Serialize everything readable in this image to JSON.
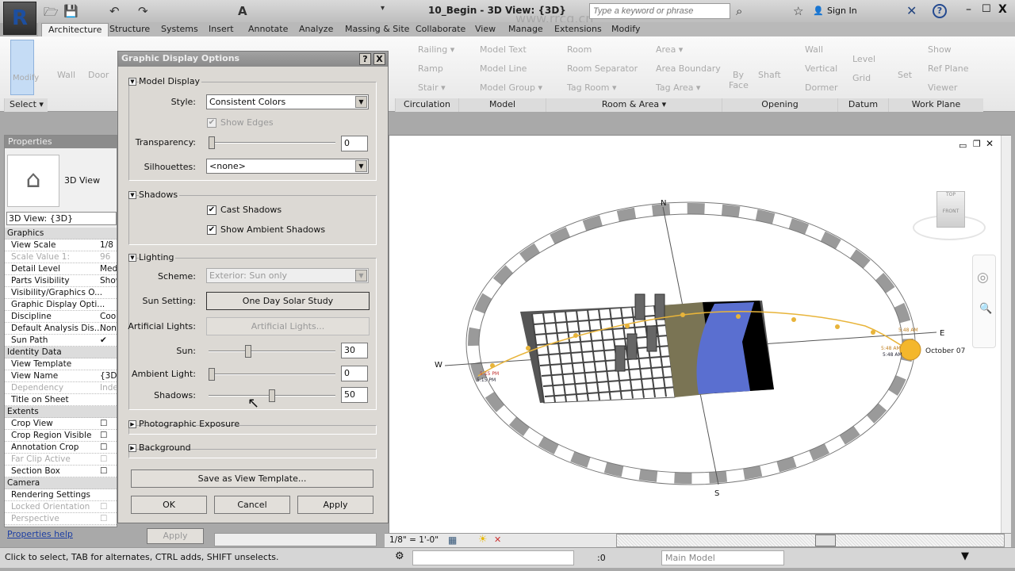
{
  "app": {
    "logo": "R",
    "window_title": "10_Begin - 3D View: {3D}",
    "search_placeholder": "Type a keyword or phrase",
    "sign_in": "Sign In",
    "help": "?",
    "watermark": "www.rrcg.cn"
  },
  "tabs": [
    "Architecture",
    "Structure",
    "Systems",
    "Insert",
    "Annotate",
    "Analyze",
    "Massing & Site",
    "Collaborate",
    "View",
    "Manage",
    "Extensions",
    "Modify"
  ],
  "ribbon": {
    "select": {
      "modify": "Modify",
      "label": "Select ▾"
    },
    "build": [
      "Wall",
      "Door"
    ],
    "circulation": {
      "items": [
        "Railing ▾",
        "Ramp",
        "Stair ▾"
      ],
      "label": "Circulation"
    },
    "model": {
      "items": [
        "Model Text",
        "Model Line",
        "Model Group ▾"
      ],
      "label": "Model"
    },
    "room_area": {
      "items": [
        "Room",
        "Room Separator",
        "Tag Room ▾",
        "Area ▾",
        "Area Boundary",
        "Tag Area ▾"
      ],
      "label": "Room & Area ▾"
    },
    "opening": {
      "items": [
        "By Face",
        "Shaft",
        "Wall",
        "Vertical",
        "Dormer"
      ],
      "label": "Opening"
    },
    "datum": {
      "items": [
        "Level",
        "Grid"
      ],
      "label": "Datum"
    },
    "work_plane": {
      "items": [
        "Set",
        "Show",
        "Ref Plane",
        "Viewer"
      ],
      "label": "Work Plane"
    }
  },
  "properties": {
    "title": "Properties",
    "type_name": "3D View",
    "selector": "3D View: {3D}",
    "rows": [
      {
        "label": "Graphics",
        "group": true
      },
      {
        "label": "View Scale",
        "value": "1/8"
      },
      {
        "label": "Scale Value    1:",
        "value": "96",
        "disabled": true
      },
      {
        "label": "Detail Level",
        "value": "Med"
      },
      {
        "label": "Parts Visibility",
        "value": "Show"
      },
      {
        "label": "Visibility/Graphics O...",
        "value": ""
      },
      {
        "label": "Graphic Display Opti...",
        "value": ""
      },
      {
        "label": "Discipline",
        "value": "Coo"
      },
      {
        "label": "Default Analysis Dis...",
        "value": "Non"
      },
      {
        "label": "Sun Path",
        "value": "✔"
      },
      {
        "label": "Identity Data",
        "group": true
      },
      {
        "label": "View Template",
        "value": ""
      },
      {
        "label": "View Name",
        "value": "{3D}"
      },
      {
        "label": "Dependency",
        "value": "Inde",
        "disabled": true
      },
      {
        "label": "Title on Sheet",
        "value": ""
      },
      {
        "label": "Extents",
        "group": true
      },
      {
        "label": "Crop View",
        "value": "☐"
      },
      {
        "label": "Crop Region Visible",
        "value": "☐"
      },
      {
        "label": "Annotation Crop",
        "value": "☐"
      },
      {
        "label": "Far Clip Active",
        "value": "☐",
        "disabled": true
      },
      {
        "label": "Section Box",
        "value": "☐"
      },
      {
        "label": "Camera",
        "group": true
      },
      {
        "label": "Rendering Settings",
        "value": ""
      },
      {
        "label": "Locked Orientation",
        "value": "☐",
        "disabled": true
      },
      {
        "label": "Perspective",
        "value": "☐",
        "disabled": true
      }
    ],
    "help_link": "Properties help",
    "apply": "Apply"
  },
  "dialog": {
    "title": "Graphic Display Options",
    "help": "?",
    "close": "X",
    "model_display": {
      "header": "Model Display",
      "style_label": "Style:",
      "style_value": "Consistent Colors",
      "show_edges": "Show Edges",
      "show_edges_checked": true,
      "transparency_label": "Transparency:",
      "transparency": "0",
      "silhouettes_label": "Silhouettes:",
      "silhouettes_value": "<none>"
    },
    "shadows": {
      "header": "Shadows",
      "cast_shadows": "Cast Shadows",
      "cast_checked": true,
      "ambient_shadows": "Show Ambient Shadows",
      "ambient_checked": true
    },
    "lighting": {
      "header": "Lighting",
      "scheme_label": "Scheme:",
      "scheme_value": "Exterior: Sun only",
      "sun_setting_label": "Sun Setting:",
      "sun_setting_value": "One Day Solar Study",
      "artificial_label": "Artificial Lights:",
      "artificial_button": "Artificial Lights...",
      "sun_label": "Sun:",
      "sun": "30",
      "ambient_label": "Ambient Light:",
      "ambient": "0",
      "shadows_label": "Shadows:",
      "shadows": "50"
    },
    "photographic_exposure": "Photographic Exposure",
    "background": "Background",
    "save_template": "Save as View Template...",
    "ok": "OK",
    "cancel": "Cancel",
    "apply": "Apply"
  },
  "view": {
    "compass": {
      "n": "N",
      "s": "S",
      "e": "E",
      "w": "W"
    },
    "date": "October 07",
    "sunrise": "5:48 AM",
    "sunrise2": "5:48 AM",
    "sunrise3": "5:48 AM",
    "sunset": "5:15 PM",
    "sunset2": "5:15 PM",
    "viewcube_top": "TOP",
    "viewcube_front": "FRONT"
  },
  "view_bar": {
    "scale": "1/8\" = 1'-0\""
  },
  "status": {
    "text": "Click to select, TAB for alternates, CTRL adds, SHIFT unselects.",
    "count": ":0",
    "model": "Main Model"
  }
}
